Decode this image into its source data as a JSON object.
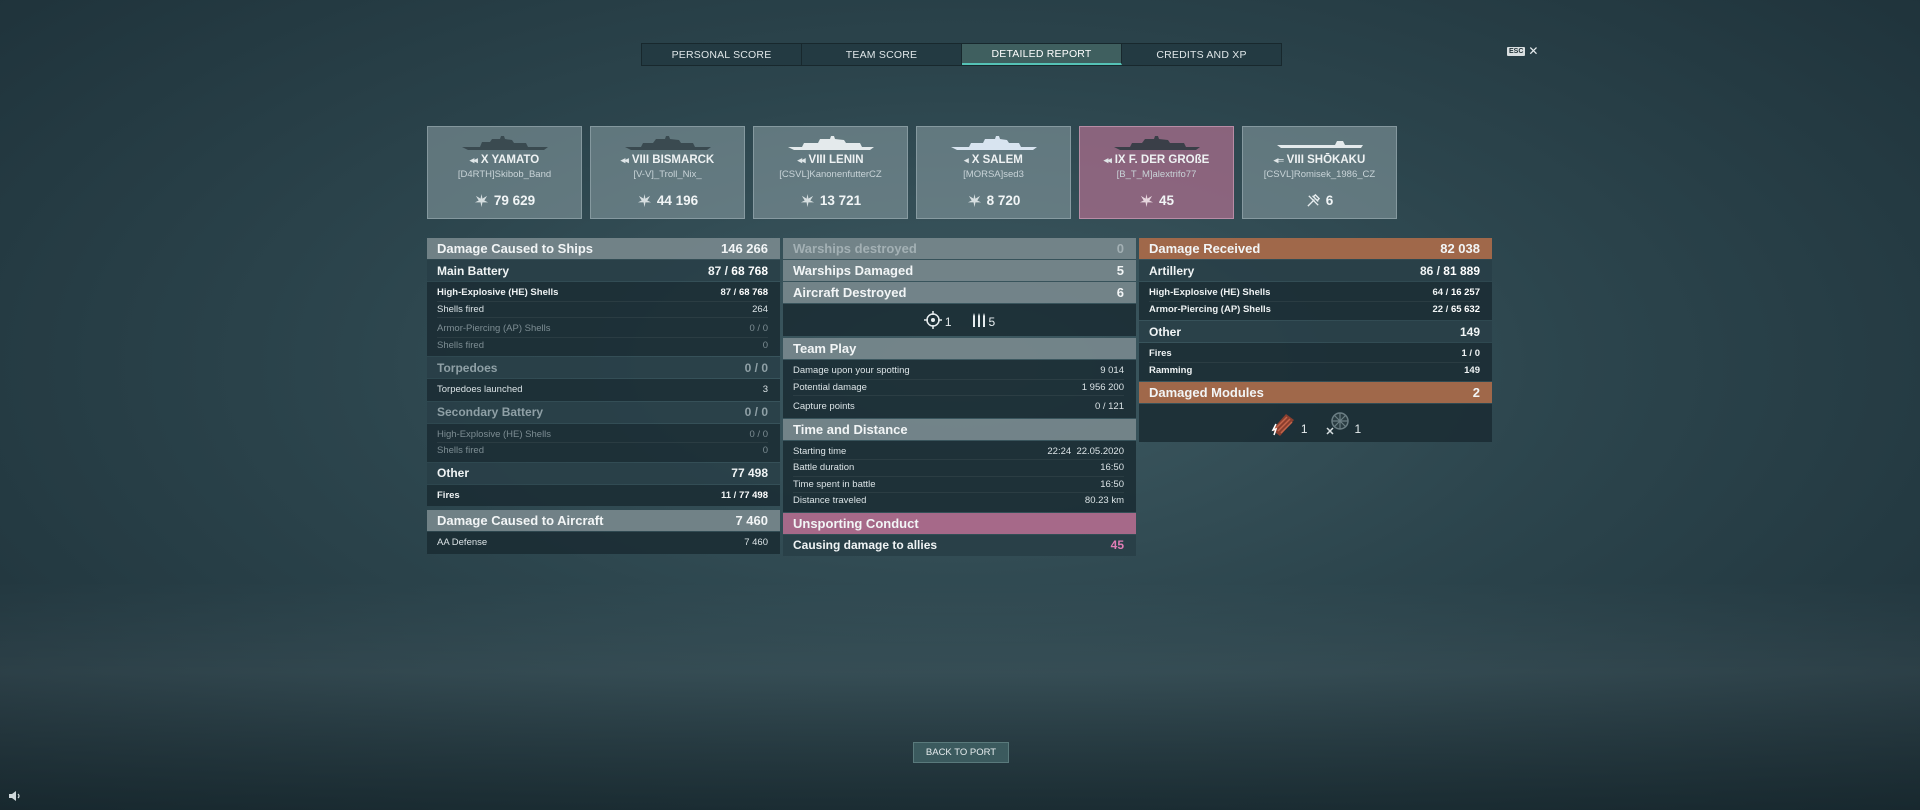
{
  "tabs": [
    "PERSONAL SCORE",
    "TEAM SCORE",
    "DETAILED REPORT",
    "CREDITS AND XP"
  ],
  "esc": {
    "key": "ESC",
    "close": "✕"
  },
  "ships": [
    {
      "name": "X YAMATO",
      "player": "[D4RTH]Skibob_Band",
      "score": "79 629",
      "icon": "damage-icon"
    },
    {
      "name": "VIII BISMARCK",
      "player": "[V-V]_Troll_Nix_",
      "score": "44 196",
      "icon": "damage-icon"
    },
    {
      "name": "VIII LENIN",
      "player": "[CSVL]KanonenfutterCZ",
      "score": "13 721",
      "icon": "damage-icon"
    },
    {
      "name": "X SALEM",
      "player": "[MORSA]sed3",
      "score": "8 720",
      "icon": "damage-icon"
    },
    {
      "name": "IX F. DER GROßE",
      "player": "[B_T_M]alextrifo77",
      "score": "45",
      "icon": "damage-icon"
    },
    {
      "name": "VIII SHŌKAKU",
      "player": "[CSVL]Romisek_1986_CZ",
      "score": "6",
      "icon": "plane-shot-icon"
    }
  ],
  "col1": {
    "damage_ships": {
      "label": "Damage Caused to Ships",
      "value": "146 266"
    },
    "main_battery": {
      "label": "Main Battery",
      "hits": "87 / ",
      "value": "68 768"
    },
    "he_shells": {
      "label": "High-Explosive (HE) Shells",
      "hits": "87 / ",
      "value": "68 768"
    },
    "he_fired": {
      "label": "Shells fired",
      "value": "264"
    },
    "ap_shells": {
      "label": "Armor-Piercing (AP) Shells",
      "value": "0 / 0"
    },
    "ap_fired": {
      "label": "Shells fired",
      "value": "0"
    },
    "torpedoes": {
      "label": "Torpedoes",
      "value": "0 / 0"
    },
    "torp_launched": {
      "label": "Torpedoes launched",
      "value": "3"
    },
    "secondary": {
      "label": "Secondary Battery",
      "value": "0 / 0"
    },
    "sec_he": {
      "label": "High-Explosive (HE) Shells",
      "value": "0 / 0"
    },
    "sec_fired": {
      "label": "Shells fired",
      "value": "0"
    },
    "other": {
      "label": "Other",
      "value": "77 498"
    },
    "fires": {
      "label": "Fires",
      "hits": "11 / ",
      "value": "77 498"
    },
    "damage_aircraft": {
      "label": "Damage Caused to Aircraft",
      "value": "7 460"
    },
    "aa_defense": {
      "label": "AA Defense",
      "value": "7 460"
    }
  },
  "col2": {
    "destroyed": {
      "label": "Warships destroyed",
      "value": "0"
    },
    "damaged": {
      "label": "Warships Damaged",
      "value": "5"
    },
    "aircraft": {
      "label": "Aircraft Destroyed",
      "value": "6"
    },
    "spotted": "1",
    "ribbons": "5",
    "teamplay": {
      "label": "Team Play"
    },
    "spotting": {
      "label": "Damage upon your spotting",
      "value": "9 014"
    },
    "potential": {
      "label": "Potential damage",
      "value": "1 956 200"
    },
    "capture": {
      "label": "Capture points",
      "value": "0 / 121"
    },
    "timedist": {
      "label": "Time and Distance"
    },
    "start": {
      "label": "Starting time",
      "value": "22:24  22.05.2020"
    },
    "duration": {
      "label": "Battle duration",
      "value": "16:50"
    },
    "spent": {
      "label": "Time spent in battle",
      "value": "16:50"
    },
    "distance": {
      "label": "Distance traveled",
      "value": "80.23 km"
    },
    "unsporting": {
      "label": "Unsporting Conduct"
    },
    "allies": {
      "label": "Causing damage to allies",
      "value": "45"
    }
  },
  "col3": {
    "received": {
      "label": "Damage Received",
      "value": "82 038"
    },
    "artillery": {
      "label": "Artillery",
      "hits": "86 / ",
      "value": "81 889"
    },
    "he": {
      "label": "High-Explosive (HE) Shells",
      "hits": "64 / ",
      "value": "16 257"
    },
    "ap": {
      "label": "Armor-Piercing (AP) Shells",
      "hits": "22 / ",
      "value": "65 632"
    },
    "other": {
      "label": "Other",
      "value": "149"
    },
    "fires": {
      "label": "Fires",
      "value": "1 / 0"
    },
    "ramming": {
      "label": "Ramming",
      "value": "149"
    },
    "modules": {
      "label": "Damaged Modules",
      "value": "2"
    },
    "mod1": "1",
    "mod2": "1"
  },
  "back": "BACK TO PORT",
  "colors": {
    "accent": "#55c2b6",
    "orange": "#a0684a",
    "pink": "#a66989",
    "pinkValue": "#e07db5"
  }
}
